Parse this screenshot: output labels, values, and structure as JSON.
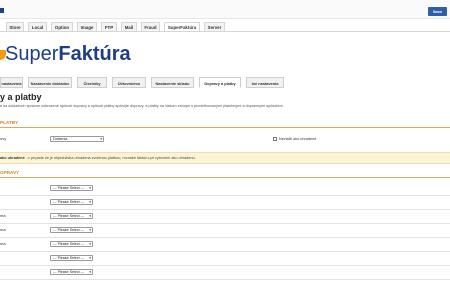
{
  "header": {
    "save_label": "Save"
  },
  "top_tabs": [
    {
      "label": "Store"
    },
    {
      "label": "Local"
    },
    {
      "label": "Option"
    },
    {
      "label": "Image"
    },
    {
      "label": "FTP"
    },
    {
      "label": "Mail"
    },
    {
      "label": "Fraud"
    },
    {
      "label": "SuperFaktúra"
    },
    {
      "label": "Server"
    }
  ],
  "brand": {
    "name_light": "Super",
    "name_bold": "Faktúra",
    "color": "#1e3d87",
    "accent": "#f39c12"
  },
  "sub_tabs": [
    {
      "label": "nastavenia"
    },
    {
      "label": "Nastavenie dokladov"
    },
    {
      "label": "Číselníky"
    },
    {
      "label": "Účtovníctvo"
    },
    {
      "label": "Nastavenie skladu"
    },
    {
      "label": "Dopravy a platby"
    },
    {
      "label": "Iné nastavenia"
    }
  ],
  "page": {
    "title": "y a platby",
    "description": "e sa dokladoch správne zobrazené spôsob dopravy a spôsob platby spárujte dopravy, a platby na Vašom eshope s predefinovanými platobnými a dopravnými spôsobmi."
  },
  "payments_section": {
    "heading": "PLATBY",
    "row_label": "ovy",
    "select_value": "Dobierka",
    "checkbox_label": "Nezlatiť ako uhradené"
  },
  "notice": {
    "bold": "ako uhradené",
    "text": " - v prípade že je objednávka uhradená zvolenou platbou, rovnaké faktúru pri vytvorení ako uhradenú."
  },
  "shipping_section": {
    "heading": "OPRAVY",
    "rows": [
      {
        "label": "",
        "select_value": "--- Please Select ---"
      },
      {
        "label": "",
        "select_value": "--- Please Select ---"
      },
      {
        "label": "ma",
        "select_value": "--- Please Select ---"
      },
      {
        "label": "ma",
        "select_value": "--- Please Select ---"
      },
      {
        "label": "ma",
        "select_value": "--- Please Select ---"
      },
      {
        "label": "",
        "select_value": "--- Please Select ---"
      },
      {
        "label": "",
        "select_value": "--- Please Select ---"
      }
    ]
  }
}
